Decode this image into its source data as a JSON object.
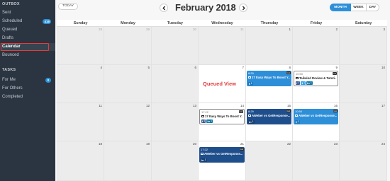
{
  "sidebar": {
    "outbox_heading": "OUTBOX",
    "outbox_items": [
      {
        "label": "Sent"
      },
      {
        "label": "Scheduled",
        "badge": "416"
      },
      {
        "label": "Queued"
      },
      {
        "label": "Drafts"
      },
      {
        "label": "Calendar",
        "active": true
      },
      {
        "label": "Bounced"
      }
    ],
    "tasks_heading": "TASKS",
    "tasks_items": [
      {
        "label": "For Me",
        "badge": "0"
      },
      {
        "label": "For Others"
      },
      {
        "label": "Completed"
      }
    ]
  },
  "toolbar": {
    "today_label": "TODAY",
    "month_title": "February 2018",
    "views": {
      "month": "MONTH",
      "week": "WEEK",
      "day": "DAY"
    },
    "active_view": "MONTH"
  },
  "calendar": {
    "weekdays": [
      "Sunday",
      "Monday",
      "Tuesday",
      "Wednesday",
      "Thursday",
      "Friday",
      "Saturday"
    ],
    "weeks": [
      [
        "28",
        "29",
        "30",
        "31",
        "1",
        "2",
        "3"
      ],
      [
        "4",
        "5",
        "6",
        "7",
        "8",
        "9",
        "10"
      ],
      [
        "11",
        "12",
        "13",
        "14",
        "15",
        "16",
        "17"
      ],
      [
        "18",
        "19",
        "20",
        "21",
        "22",
        "23",
        "24"
      ]
    ],
    "queued_label": "Queued View",
    "posts": [
      {
        "day": "8",
        "time": "8:29",
        "tag": "GH",
        "title": "17 Easy Ways To Boost Y...",
        "socials": [
          {
            "net": "tw",
            "count": "1"
          }
        ]
      },
      {
        "day": "9",
        "time": "10:50",
        "tag": "GH",
        "title": "Tailwind Review & Tutori...",
        "socials": [
          {
            "net": "fb",
            "count": "1"
          },
          {
            "net": "tw",
            "count": "1"
          },
          {
            "net": "li",
            "count": "1"
          }
        ]
      },
      {
        "day": "14",
        "time": "17:22",
        "tag": "GH",
        "title": "17 Easy Ways To Boost Y...",
        "socials": [
          {
            "net": "fb",
            "count": "1"
          },
          {
            "net": "li",
            "count": "1"
          }
        ]
      },
      {
        "day": "15",
        "time": "8:29",
        "tag": "GH",
        "title": "AWeber vs GetResponse...",
        "socials": [
          {
            "net": "li",
            "count": "1"
          }
        ]
      },
      {
        "day": "16",
        "time": "10:50",
        "tag": "GH",
        "title": "AWeber vs GetResponse...",
        "socials": [
          {
            "net": "tw",
            "count": "1"
          }
        ]
      },
      {
        "day": "21",
        "time": "17:22",
        "tag": "GH",
        "title": "AWeber vs GetResponse...",
        "socials": [
          {
            "net": "li",
            "count": "1"
          }
        ]
      }
    ]
  },
  "colors": {
    "sidebar_bg": "#2b3541",
    "accent": "#2e8fd9",
    "highlight_red": "#e53b3b",
    "post_navy": "#1f4e8c"
  }
}
